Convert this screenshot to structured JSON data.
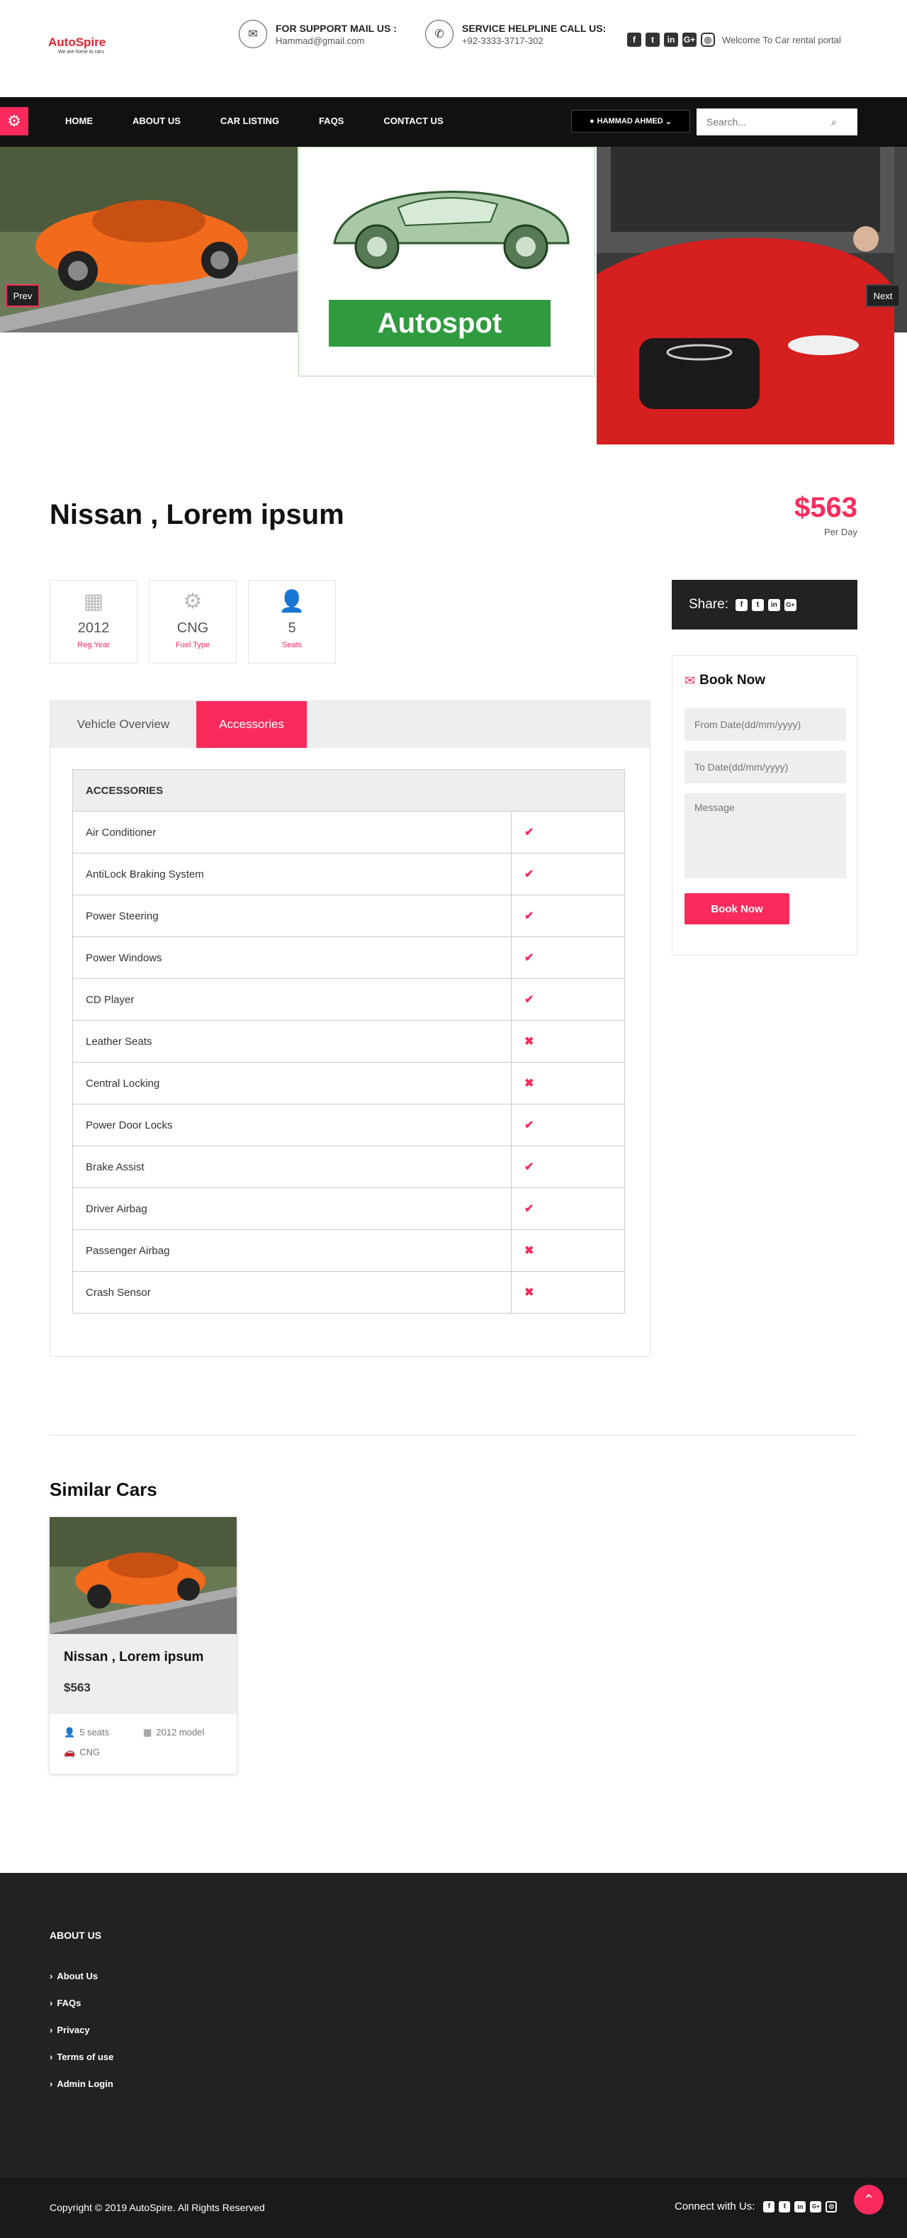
{
  "brand": {
    "name": "AutoSpire",
    "tagline": "We are home to cars"
  },
  "support": {
    "title": "FOR SUPPORT MAIL US :",
    "value": "Hammad@gmail.com"
  },
  "helpline": {
    "title": "SERVICE HELPLINE CALL US:",
    "value": "+92-3333-3717-302"
  },
  "welcome": "Welcome To Car rental portal",
  "nav": {
    "items": [
      "HOME",
      "ABOUT US",
      "CAR LISTING",
      "FAQS",
      "CONTACT US"
    ],
    "user": "HAMMAD AHMED",
    "search_placeholder": "Search..."
  },
  "slider": {
    "prev": "Prev",
    "next": "Next",
    "logo_text": "Autospot"
  },
  "car": {
    "title": "Nissan , Lorem ipsum",
    "price": "$563",
    "price_unit": "Per Day"
  },
  "features": [
    {
      "icon": "calendar-icon",
      "value": "2012",
      "label": "Reg.Year"
    },
    {
      "icon": "cogs-icon",
      "value": "CNG",
      "label": "Fuel Type"
    },
    {
      "icon": "user-plus-icon",
      "value": "5",
      "label": "Seats"
    }
  ],
  "tabs": [
    "Vehicle Overview",
    "Accessories"
  ],
  "accessories": {
    "header": "ACCESSORIES",
    "rows": [
      {
        "name": "Air Conditioner",
        "available": true
      },
      {
        "name": "AntiLock Braking System",
        "available": true
      },
      {
        "name": "Power Steering",
        "available": true
      },
      {
        "name": "Power Windows",
        "available": true
      },
      {
        "name": "CD Player",
        "available": true
      },
      {
        "name": "Leather Seats",
        "available": false
      },
      {
        "name": "Central Locking",
        "available": false
      },
      {
        "name": "Power Door Locks",
        "available": true
      },
      {
        "name": "Brake Assist",
        "available": true
      },
      {
        "name": "Driver Airbag",
        "available": true
      },
      {
        "name": "Passenger Airbag",
        "available": false
      },
      {
        "name": "Crash Sensor",
        "available": false
      }
    ]
  },
  "share": {
    "label": "Share:"
  },
  "booking": {
    "title": "Book Now",
    "from_placeholder": "From Date(dd/mm/yyyy)",
    "to_placeholder": "To Date(dd/mm/yyyy)",
    "message_placeholder": "Message",
    "button": "Book Now"
  },
  "similar": {
    "title": "Similar Cars",
    "card": {
      "name": "Nissan , Lorem ipsum",
      "price": "$563",
      "seats": "5 seats",
      "model": "2012 model",
      "fuel": "CNG"
    }
  },
  "footer": {
    "about_title": "ABOUT US",
    "links": [
      "About Us",
      "FAQs",
      "Privacy",
      "Terms of use",
      "Admin Login"
    ],
    "copyright": "Copyright © 2019 AutoSpire. All Rights Reserved",
    "connect": "Connect with Us:"
  },
  "colors": {
    "accent": "#fa2b5c",
    "dark": "#111111",
    "footer": "#222222",
    "bottom": "#1a1a1a"
  }
}
